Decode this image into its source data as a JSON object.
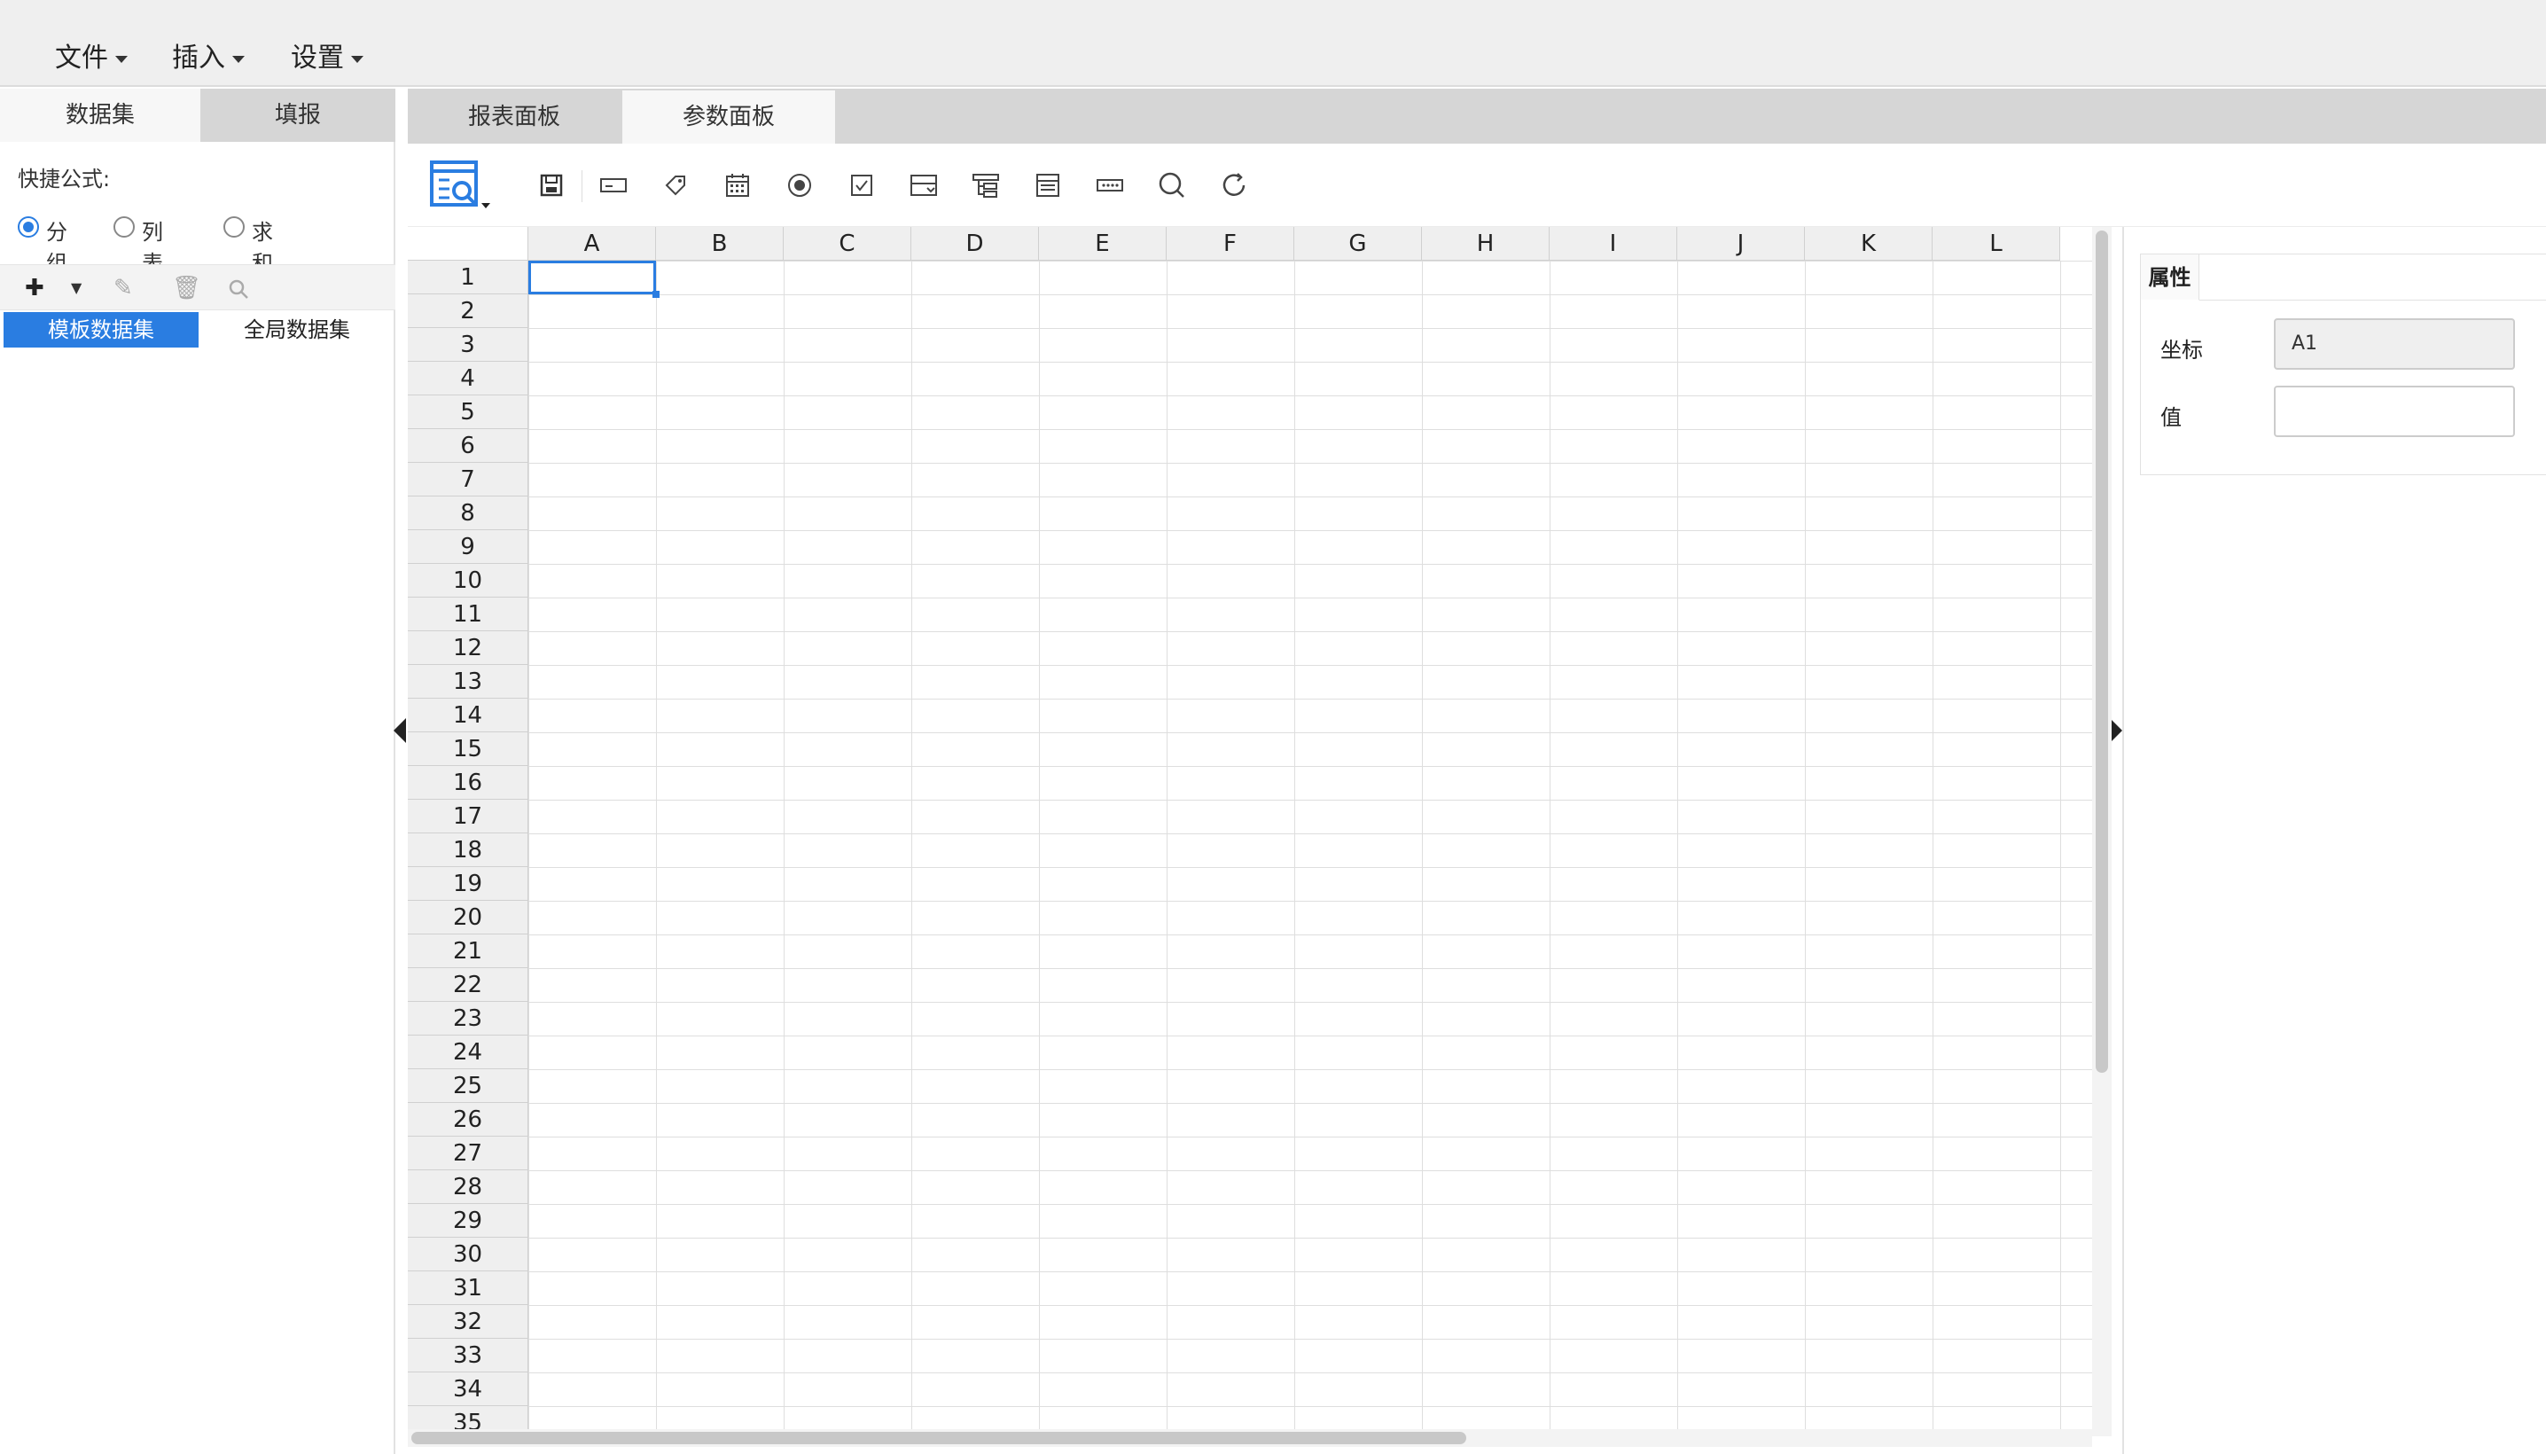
{
  "menu": {
    "items": [
      {
        "label": "文件"
      },
      {
        "label": "插入"
      },
      {
        "label": "设置"
      }
    ]
  },
  "left_panel": {
    "tabs": [
      {
        "label": "数据集",
        "active": true
      },
      {
        "label": "填报",
        "active": false
      }
    ],
    "quick_formula_label": "快捷公式:",
    "radios": [
      {
        "label": "分组",
        "checked": true
      },
      {
        "label": "列表",
        "checked": false
      },
      {
        "label": "求和",
        "checked": false
      }
    ],
    "toolbar_icons": [
      "plus-icon",
      "dropdown-arrow-icon",
      "pencil-icon",
      "trash-icon",
      "search-icon"
    ],
    "dataset_tabs": [
      {
        "label": "模板数据集",
        "active": true
      },
      {
        "label": "全局数据集",
        "active": false
      }
    ]
  },
  "main_tabs": [
    {
      "label": "报表面板",
      "active": false
    },
    {
      "label": "参数面板",
      "active": true
    }
  ],
  "toolbar_icons": [
    "query-button-icon",
    "save-icon",
    "text-field-icon",
    "tag-icon",
    "calendar-icon",
    "radio-icon",
    "checkbox-icon",
    "dropdown-box-icon",
    "tree-icon",
    "list-icon",
    "password-icon",
    "search-icon",
    "refresh-icon"
  ],
  "grid": {
    "columns": [
      "A",
      "B",
      "C",
      "D",
      "E",
      "F",
      "G",
      "H",
      "I",
      "J",
      "K",
      "L"
    ],
    "rows": [
      "1",
      "2",
      "3",
      "4",
      "5",
      "6",
      "7",
      "8",
      "9",
      "10",
      "11",
      "12",
      "13",
      "14",
      "15",
      "16",
      "17",
      "18",
      "19",
      "20",
      "21",
      "22",
      "23",
      "24",
      "25",
      "26",
      "27",
      "28",
      "29",
      "30",
      "31",
      "32",
      "33",
      "34",
      "35"
    ],
    "selected_cell": "A1"
  },
  "properties": {
    "tab_label": "属性",
    "coord_label": "坐标",
    "coord_value": "A1",
    "value_label": "值",
    "value_value": ""
  },
  "colors": {
    "accent": "#2a7de1",
    "tab_bg": "#d6d6d6",
    "header_bg": "#efefef"
  }
}
